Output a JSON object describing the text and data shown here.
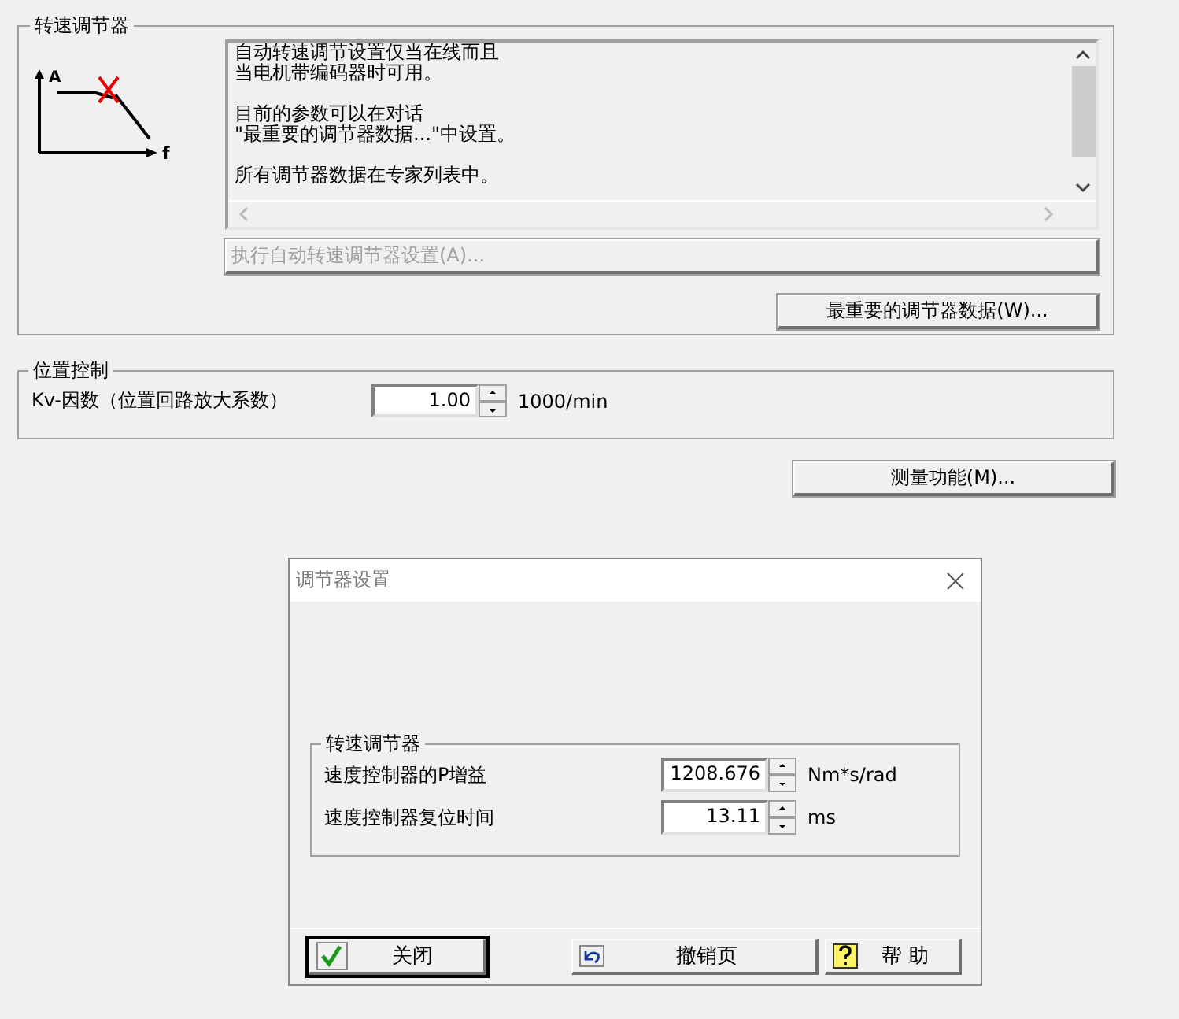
{
  "speed_controller": {
    "title": "转速调节器",
    "graph_labels": {
      "y": "A",
      "x": "f"
    },
    "info_paragraphs": [
      [
        "自动转速调节设置仅当在线而且",
        "当电机带编码器时可用。"
      ],
      [
        "目前的参数可以在对话",
        "\"最重要的调节器数据...\"中设置。"
      ],
      [
        "所有调节器数据在专家列表中。"
      ]
    ],
    "auto_button": {
      "label": "执行自动转速调节器设置(A)...",
      "disabled": true
    },
    "data_button": {
      "label": "最重要的调节器数据(W)...",
      "disabled": false
    }
  },
  "position_control": {
    "title": "位置控制",
    "fields": [
      {
        "label": "Kv-因数（位置回路放大系数）",
        "value": "1.00",
        "unit": "1000/min"
      }
    ]
  },
  "measure_button": {
    "label": "测量功能(M)...",
    "disabled": false
  },
  "dialog": {
    "title": "调节器设置",
    "group_title": "转速调节器",
    "fields": [
      {
        "label": "速度控制器的P增益",
        "value": "1208.676",
        "unit": "Nm*s/rad"
      },
      {
        "label": "速度控制器复位时间",
        "value": "13.11",
        "unit": "ms"
      }
    ],
    "buttons": [
      {
        "kind": "close",
        "label": "关闭"
      },
      {
        "kind": "undo",
        "label": "撤销页"
      },
      {
        "kind": "help",
        "label": "帮 助"
      }
    ]
  }
}
